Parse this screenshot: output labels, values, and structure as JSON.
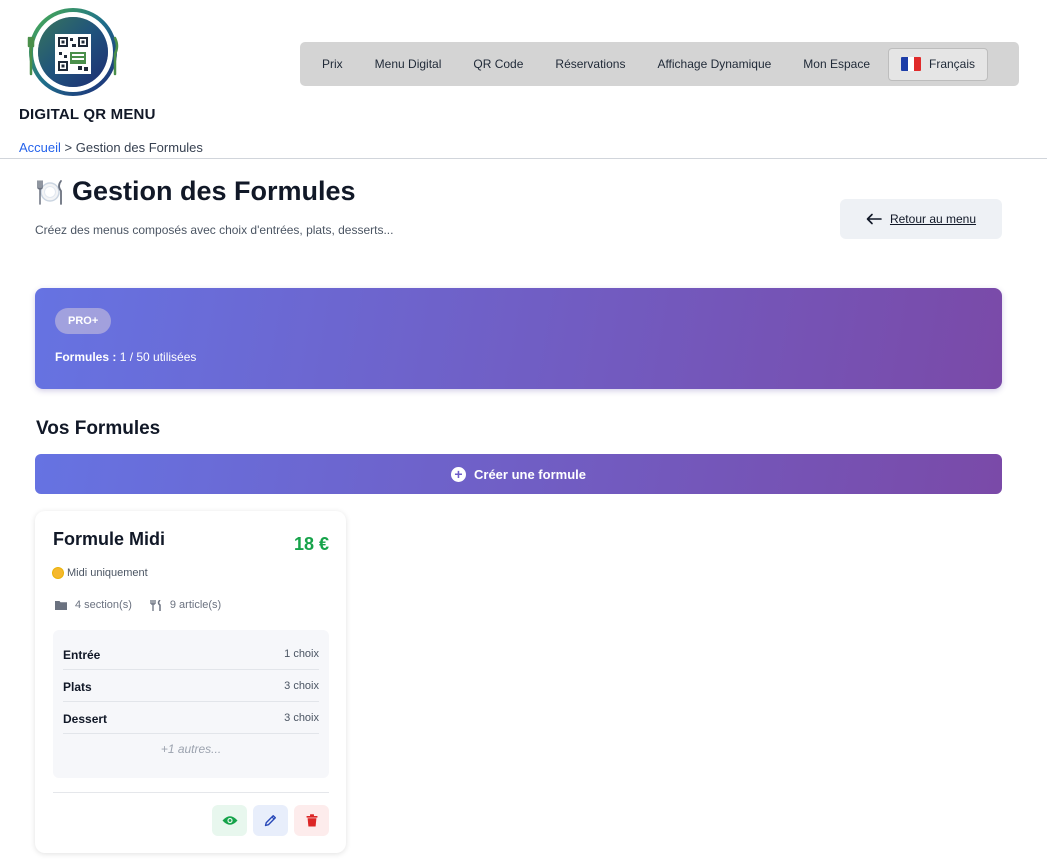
{
  "brand": {
    "name": "DIGITAL QR MENU"
  },
  "nav": {
    "items": [
      "Prix",
      "Menu Digital",
      "QR Code",
      "Réservations",
      "Affichage Dynamique",
      "Mon Espace"
    ],
    "language": "Français"
  },
  "breadcrumb": {
    "home": "Accueil",
    "separator": " > ",
    "current": "Gestion des Formules"
  },
  "page": {
    "title": "Gestion des Formules",
    "subtitle": "Créez des menus composés avec choix d'entrées, plats, desserts...",
    "back_label": "Retour au menu"
  },
  "plan": {
    "badge": "PRO+",
    "usage_label": "Formules :",
    "usage_value": "1 / 50 utilisées"
  },
  "formulas_section": {
    "title": "Vos Formules",
    "create_label": "Créer une formule"
  },
  "formula": {
    "name": "Formule Midi",
    "price": "18 €",
    "availability": "Midi uniquement",
    "sections_count": "4 section(s)",
    "articles_count": "9 article(s)",
    "sections": [
      {
        "name": "Entrée",
        "choices": "1 choix"
      },
      {
        "name": "Plats",
        "choices": "3 choix"
      },
      {
        "name": "Dessert",
        "choices": "3 choix"
      }
    ],
    "more": "+1 autres..."
  },
  "colors": {
    "accent_start": "#6673e2",
    "accent_end": "#7a4aa8",
    "price": "#16a34a",
    "link": "#2563eb"
  },
  "icons": [
    "qr-logo-icon",
    "french-flag-icon",
    "plate-cutlery-icon",
    "arrow-left-icon",
    "plus-circle-icon",
    "sun-icon",
    "folder-icon",
    "cutlery-icon",
    "eye-icon",
    "pencil-icon",
    "trash-icon"
  ]
}
